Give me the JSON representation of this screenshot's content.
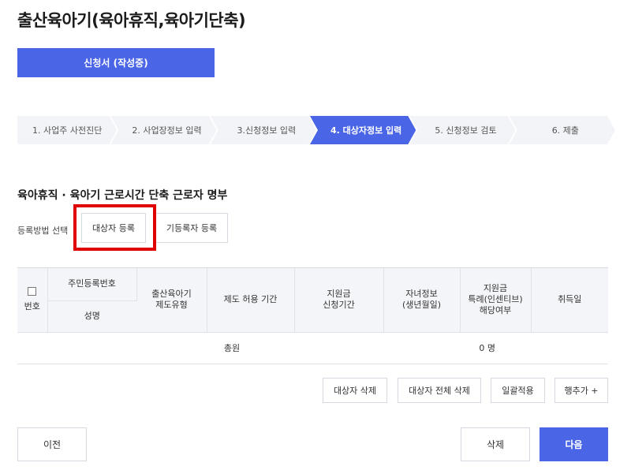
{
  "page": {
    "title": "출산육아기(육아휴직,육아기단축)"
  },
  "status": {
    "label": "신청서 (작성중)"
  },
  "steps": [
    {
      "label": "1. 사업주 사전진단"
    },
    {
      "label": "2. 사업장정보 입력"
    },
    {
      "label": "3.신청정보 입력"
    },
    {
      "label": "4. 대상자정보 입력"
    },
    {
      "label": "5. 신청정보 검토"
    },
    {
      "label": "6. 제출"
    }
  ],
  "section": {
    "title": "육아휴직 · 육아기 근로시간 단축 근로자 명부"
  },
  "register": {
    "label": "등록방법 선택",
    "target_button": "대상자 등록",
    "existing_button": "기등록자 등록"
  },
  "table": {
    "headers": {
      "number": "번호",
      "rrn": "주민등록번호",
      "name": "성명",
      "type_line1": "출산육아기",
      "type_line2": "제도유형",
      "period": "제도 허용 기간",
      "grant_line1": "지원금",
      "grant_line2": "신청기간",
      "child_line1": "자녀정보",
      "child_line2": "(생년월일)",
      "incentive_line1": "지원금",
      "incentive_line2": "특례(인센티브)",
      "incentive_line3": "해당여부",
      "acquired": "취득일"
    },
    "summary": {
      "label": "총원",
      "count": "0 명"
    }
  },
  "actions": {
    "delete_target": "대상자 삭제",
    "delete_all": "대상자 전체 삭제",
    "apply_all": "일괄적용",
    "add_row": "행추가 +"
  },
  "nav": {
    "prev": "이전",
    "delete": "삭제",
    "next": "다음"
  },
  "colors": {
    "accent": "#4a66e6",
    "highlight": "#e00000"
  }
}
